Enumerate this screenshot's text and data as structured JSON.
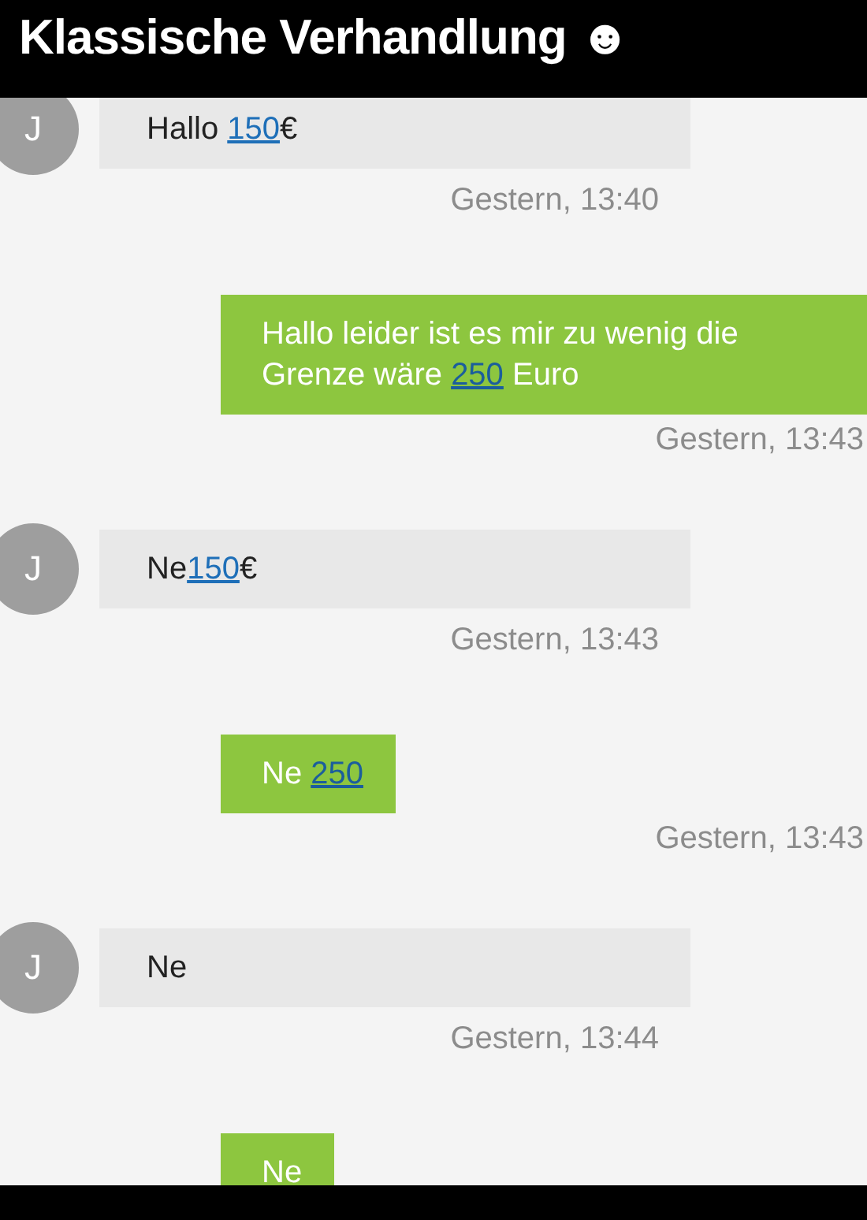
{
  "title": "Klassische Verhandlung ☻",
  "messages": [
    {
      "kind": "received",
      "avatar": "J",
      "parts": [
        {
          "text": "Hallo "
        },
        {
          "text": "150",
          "link": true
        },
        {
          "text": "€"
        }
      ],
      "time": "Gestern, 13:40"
    },
    {
      "kind": "sent",
      "parts": [
        {
          "text": "Hallo leider ist es mir zu wenig die Grenze wäre "
        },
        {
          "text": "250",
          "link": true
        },
        {
          "text": " Euro"
        }
      ],
      "time": "Gestern, 13:43"
    },
    {
      "kind": "received",
      "avatar": "J",
      "parts": [
        {
          "text": "Ne"
        },
        {
          "text": "150",
          "link": true
        },
        {
          "text": "€"
        }
      ],
      "time": "Gestern, 13:43"
    },
    {
      "kind": "sent",
      "parts": [
        {
          "text": "Ne "
        },
        {
          "text": "250",
          "link": true
        }
      ],
      "time": "Gestern, 13:43"
    },
    {
      "kind": "received",
      "avatar": "J",
      "parts": [
        {
          "text": "Ne"
        }
      ],
      "time": "Gestern, 13:44"
    },
    {
      "kind": "sent",
      "parts": [
        {
          "text": "Ne"
        }
      ]
    }
  ]
}
